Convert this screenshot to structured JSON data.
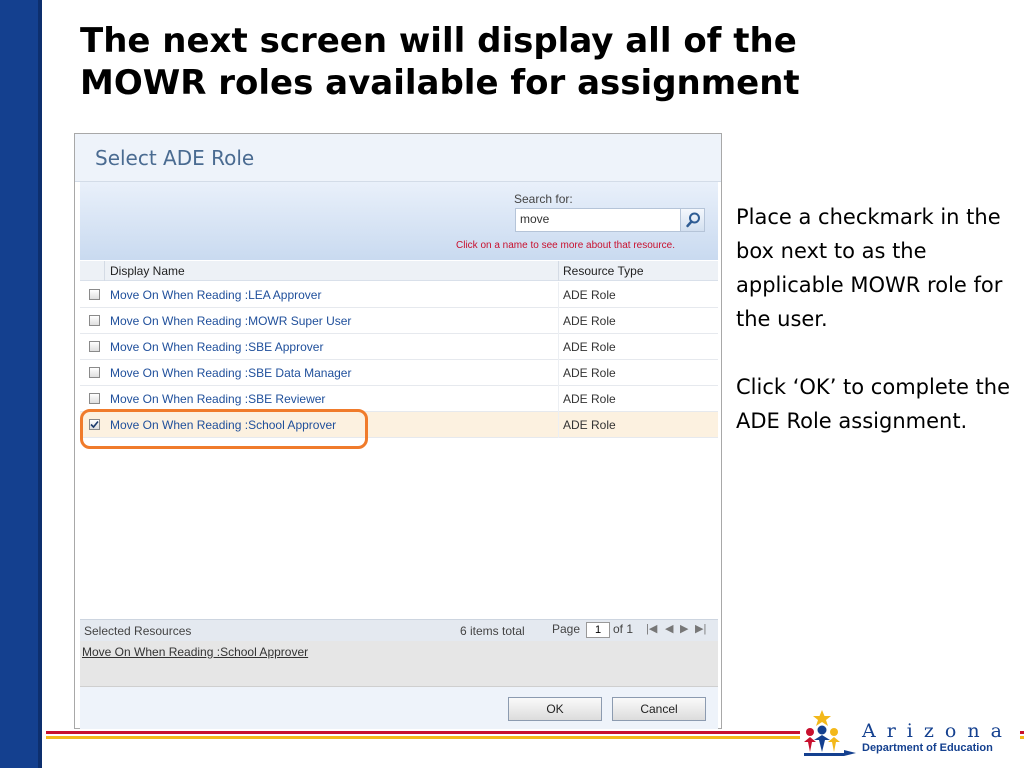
{
  "slide": {
    "title_line1": "The next screen will display all of the",
    "title_line2": "MOWR roles available for assignment",
    "instructions": [
      "Place a checkmark in the box next to as the applicable MOWR role for the user.",
      "Click ‘OK’ to complete the ADE Role assignment."
    ],
    "colors": {
      "left_bar": "#14408f",
      "line_red": "#c8102e",
      "line_gold": "#f3b81a",
      "highlight": "#f07b2b"
    }
  },
  "dialog": {
    "title": "Select ADE Role",
    "search": {
      "label": "Search for:",
      "value": "move",
      "hint": "Click on a name to see more about that resource.",
      "button_icon": "search-icon"
    },
    "columns": [
      "Display Name",
      "Resource Type"
    ],
    "rows": [
      {
        "name": "Move On When Reading :LEA Approver",
        "type": "ADE Role",
        "checked": false
      },
      {
        "name": "Move On When Reading :MOWR Super User",
        "type": "ADE Role",
        "checked": false
      },
      {
        "name": "Move On When Reading :SBE Approver",
        "type": "ADE Role",
        "checked": false
      },
      {
        "name": "Move On When Reading :SBE Data Manager",
        "type": "ADE Role",
        "checked": false
      },
      {
        "name": "Move On When Reading :SBE Reviewer",
        "type": "ADE Role",
        "checked": false
      },
      {
        "name": "Move On When Reading :School Approver",
        "type": "ADE Role",
        "checked": true
      }
    ],
    "pager": {
      "selected_label": "Selected Resources",
      "items_total": "6 items total",
      "page_label": "Page",
      "page_value": "1",
      "of_label": "of 1",
      "first_icon": "first-page-icon",
      "prev_icon": "prev-page-icon",
      "next_icon": "next-page-icon",
      "last_icon": "last-page-icon"
    },
    "selected_items": [
      "Move On When Reading :School Approver"
    ],
    "buttons": {
      "ok": "OK",
      "cancel": "Cancel"
    }
  },
  "logo": {
    "word": "Arizona",
    "sub": "Department of Education",
    "icon": "arizona-ade-logo-icon"
  }
}
